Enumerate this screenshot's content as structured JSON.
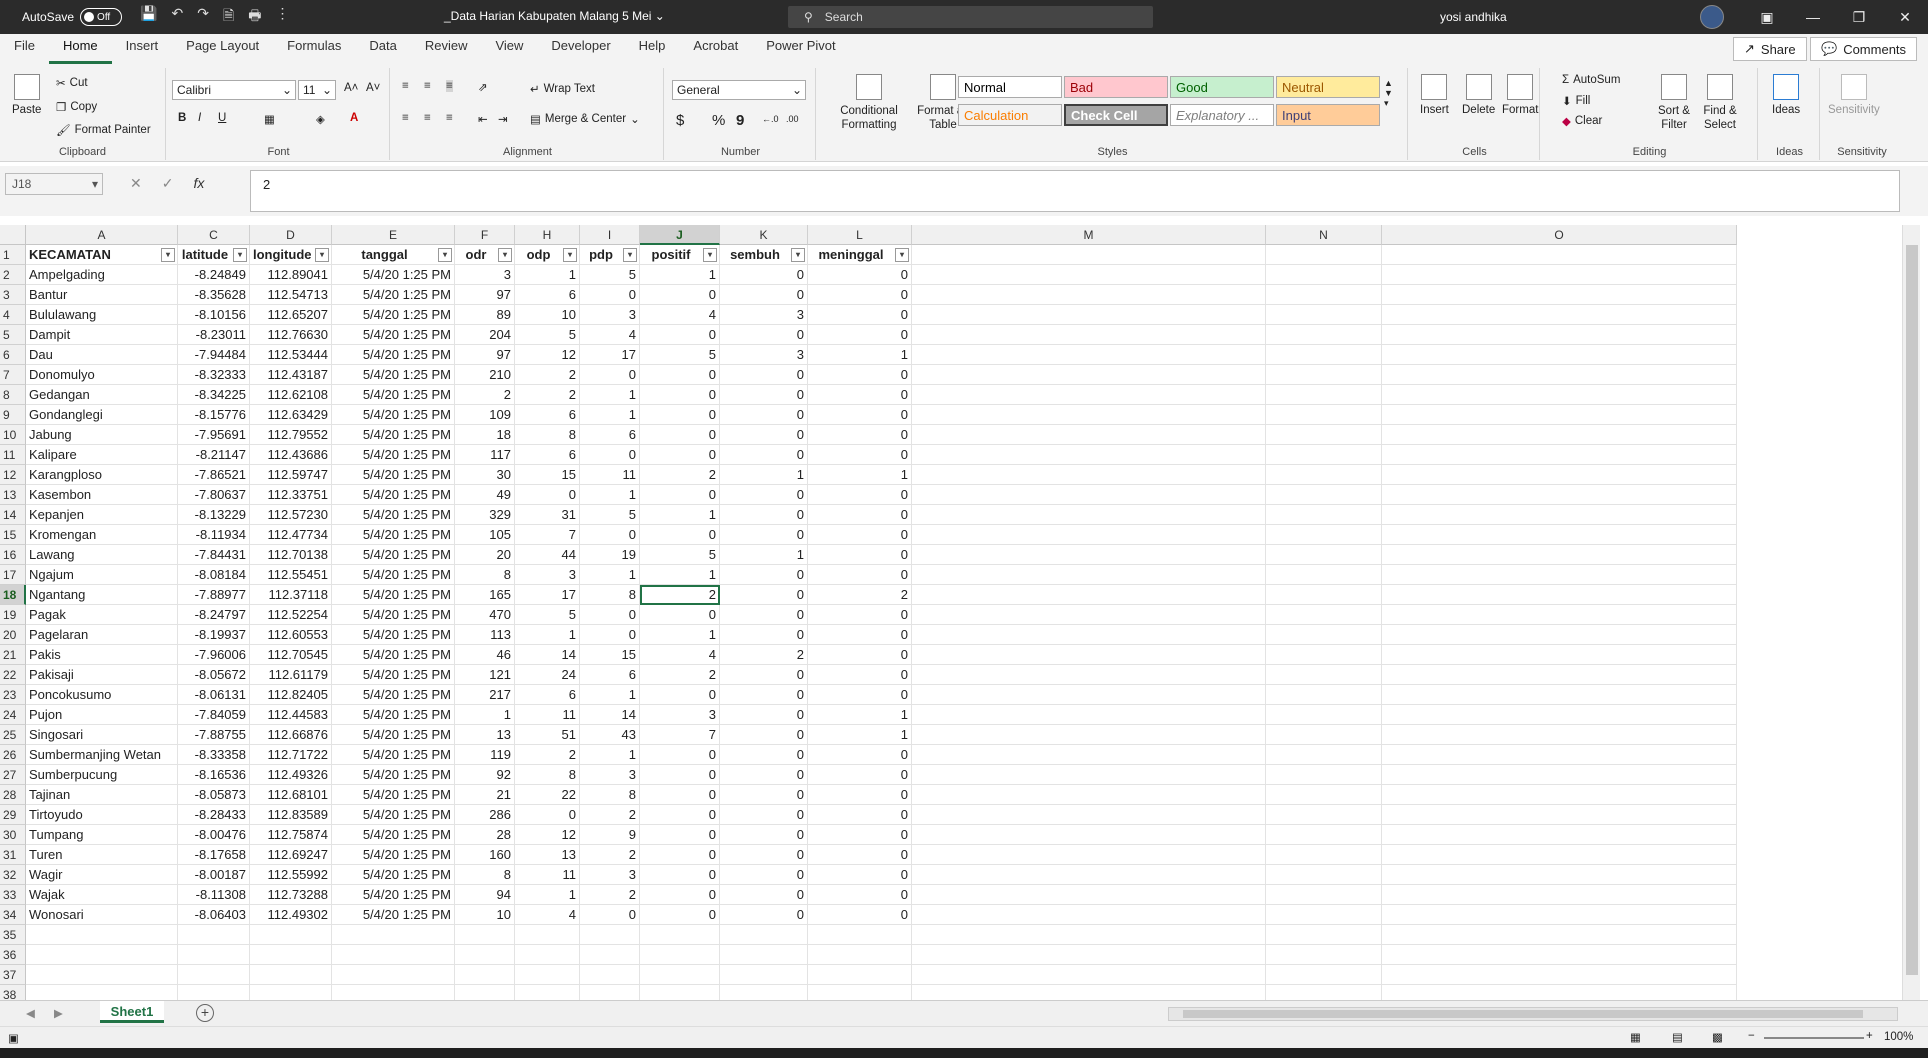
{
  "titlebar": {
    "autosave_label": "AutoSave",
    "autosave_state": "Off",
    "doc_title": "_Data Harian Kabupaten Malang 5 Mei ⌄",
    "search_placeholder": "Search",
    "user_name": "yosi andhika"
  },
  "menu": {
    "tabs": [
      "File",
      "Home",
      "Insert",
      "Page Layout",
      "Formulas",
      "Data",
      "Review",
      "View",
      "Developer",
      "Help",
      "Acrobat",
      "Power Pivot"
    ],
    "active": "Home",
    "share": "Share",
    "comments": "Comments"
  },
  "ribbon": {
    "clipboard": {
      "paste": "Paste",
      "cut": "Cut",
      "copy": "Copy",
      "format_painter": "Format Painter",
      "label": "Clipboard"
    },
    "font": {
      "name": "Calibri",
      "size": "11",
      "bold": "B",
      "italic": "I",
      "underline": "U",
      "label": "Font"
    },
    "alignment": {
      "wrap": "Wrap Text",
      "merge": "Merge & Center",
      "label": "Alignment"
    },
    "number": {
      "format": "General",
      "label": "Number"
    },
    "styles": {
      "conditional": "Conditional Formatting",
      "format_table": "Format as Table",
      "cells": [
        {
          "name": "Normal",
          "bg": "#ffffff",
          "fg": "#000000"
        },
        {
          "name": "Bad",
          "bg": "#ffc7ce",
          "fg": "#9c0006"
        },
        {
          "name": "Good",
          "bg": "#c6efce",
          "fg": "#006100"
        },
        {
          "name": "Neutral",
          "bg": "#ffeb9c",
          "fg": "#9c5700"
        },
        {
          "name": "Calculation",
          "bg": "#f2f2f2",
          "fg": "#fa7d00"
        },
        {
          "name": "Check Cell",
          "bg": "#a5a5a5",
          "fg": "#ffffff"
        },
        {
          "name": "Explanatory ...",
          "bg": "#ffffff",
          "fg": "#7f7f7f"
        },
        {
          "name": "Input",
          "bg": "#ffcc99",
          "fg": "#3f3f76"
        }
      ],
      "label": "Styles"
    },
    "cells": {
      "insert": "Insert",
      "delete": "Delete",
      "format": "Format",
      "label": "Cells"
    },
    "editing": {
      "autosum": "AutoSum",
      "fill": "Fill",
      "clear": "Clear",
      "sort": "Sort & Filter",
      "find": "Find & Select",
      "label": "Editing"
    },
    "ideas": {
      "ideas": "Ideas",
      "label": "Ideas"
    },
    "sensitivity": {
      "sensitivity": "Sensitivity",
      "label": "Sensitivity"
    }
  },
  "formula_bar": {
    "name_box": "J18",
    "fx": "fx",
    "value": "2"
  },
  "columns": [
    "A",
    "C",
    "D",
    "E",
    "F",
    "H",
    "I",
    "J",
    "K",
    "L",
    "M",
    "N",
    "O"
  ],
  "selected_column": "J",
  "selected_row": 18,
  "headers": [
    "KECAMATAN",
    "latitude",
    "longitude",
    "tanggal",
    "odr",
    "odp",
    "pdp",
    "positif",
    "sembuh",
    "meninggal"
  ],
  "rows": [
    [
      "Ampelgading",
      "-8.24849",
      "112.89041",
      "5/4/20 1:25 PM",
      "3",
      "1",
      "5",
      "1",
      "0",
      "0"
    ],
    [
      "Bantur",
      "-8.35628",
      "112.54713",
      "5/4/20 1:25 PM",
      "97",
      "6",
      "0",
      "0",
      "0",
      "0"
    ],
    [
      "Bululawang",
      "-8.10156",
      "112.65207",
      "5/4/20 1:25 PM",
      "89",
      "10",
      "3",
      "4",
      "3",
      "0"
    ],
    [
      "Dampit",
      "-8.23011",
      "112.76630",
      "5/4/20 1:25 PM",
      "204",
      "5",
      "4",
      "0",
      "0",
      "0"
    ],
    [
      "Dau",
      "-7.94484",
      "112.53444",
      "5/4/20 1:25 PM",
      "97",
      "12",
      "17",
      "5",
      "3",
      "1"
    ],
    [
      "Donomulyo",
      "-8.32333",
      "112.43187",
      "5/4/20 1:25 PM",
      "210",
      "2",
      "0",
      "0",
      "0",
      "0"
    ],
    [
      "Gedangan",
      "-8.34225",
      "112.62108",
      "5/4/20 1:25 PM",
      "2",
      "2",
      "1",
      "0",
      "0",
      "0"
    ],
    [
      "Gondanglegi",
      "-8.15776",
      "112.63429",
      "5/4/20 1:25 PM",
      "109",
      "6",
      "1",
      "0",
      "0",
      "0"
    ],
    [
      "Jabung",
      "-7.95691",
      "112.79552",
      "5/4/20 1:25 PM",
      "18",
      "8",
      "6",
      "0",
      "0",
      "0"
    ],
    [
      "Kalipare",
      "-8.21147",
      "112.43686",
      "5/4/20 1:25 PM",
      "117",
      "6",
      "0",
      "0",
      "0",
      "0"
    ],
    [
      "Karangploso",
      "-7.86521",
      "112.59747",
      "5/4/20 1:25 PM",
      "30",
      "15",
      "11",
      "2",
      "1",
      "1"
    ],
    [
      "Kasembon",
      "-7.80637",
      "112.33751",
      "5/4/20 1:25 PM",
      "49",
      "0",
      "1",
      "0",
      "0",
      "0"
    ],
    [
      "Kepanjen",
      "-8.13229",
      "112.57230",
      "5/4/20 1:25 PM",
      "329",
      "31",
      "5",
      "1",
      "0",
      "0"
    ],
    [
      "Kromengan",
      "-8.11934",
      "112.47734",
      "5/4/20 1:25 PM",
      "105",
      "7",
      "0",
      "0",
      "0",
      "0"
    ],
    [
      "Lawang",
      "-7.84431",
      "112.70138",
      "5/4/20 1:25 PM",
      "20",
      "44",
      "19",
      "5",
      "1",
      "0"
    ],
    [
      "Ngajum",
      "-8.08184",
      "112.55451",
      "5/4/20 1:25 PM",
      "8",
      "3",
      "1",
      "1",
      "0",
      "0"
    ],
    [
      "Ngantang",
      "-7.88977",
      "112.37118",
      "5/4/20 1:25 PM",
      "165",
      "17",
      "8",
      "2",
      "0",
      "2"
    ],
    [
      "Pagak",
      "-8.24797",
      "112.52254",
      "5/4/20 1:25 PM",
      "470",
      "5",
      "0",
      "0",
      "0",
      "0"
    ],
    [
      "Pagelaran",
      "-8.19937",
      "112.60553",
      "5/4/20 1:25 PM",
      "113",
      "1",
      "0",
      "1",
      "0",
      "0"
    ],
    [
      "Pakis",
      "-7.96006",
      "112.70545",
      "5/4/20 1:25 PM",
      "46",
      "14",
      "15",
      "4",
      "2",
      "0"
    ],
    [
      "Pakisaji",
      "-8.05672",
      "112.61179",
      "5/4/20 1:25 PM",
      "121",
      "24",
      "6",
      "2",
      "0",
      "0"
    ],
    [
      "Poncokusumo",
      "-8.06131",
      "112.82405",
      "5/4/20 1:25 PM",
      "217",
      "6",
      "1",
      "0",
      "0",
      "0"
    ],
    [
      "Pujon",
      "-7.84059",
      "112.44583",
      "5/4/20 1:25 PM",
      "1",
      "11",
      "14",
      "3",
      "0",
      "1"
    ],
    [
      "Singosari",
      "-7.88755",
      "112.66876",
      "5/4/20 1:25 PM",
      "13",
      "51",
      "43",
      "7",
      "0",
      "1"
    ],
    [
      "Sumbermanjing Wetan",
      "-8.33358",
      "112.71722",
      "5/4/20 1:25 PM",
      "119",
      "2",
      "1",
      "0",
      "0",
      "0"
    ],
    [
      "Sumberpucung",
      "-8.16536",
      "112.49326",
      "5/4/20 1:25 PM",
      "92",
      "8",
      "3",
      "0",
      "0",
      "0"
    ],
    [
      "Tajinan",
      "-8.05873",
      "112.68101",
      "5/4/20 1:25 PM",
      "21",
      "22",
      "8",
      "0",
      "0",
      "0"
    ],
    [
      "Tirtoyudo",
      "-8.28433",
      "112.83589",
      "5/4/20 1:25 PM",
      "286",
      "0",
      "2",
      "0",
      "0",
      "0"
    ],
    [
      "Tumpang",
      "-8.00476",
      "112.75874",
      "5/4/20 1:25 PM",
      "28",
      "12",
      "9",
      "0",
      "0",
      "0"
    ],
    [
      "Turen",
      "-8.17658",
      "112.69247",
      "5/4/20 1:25 PM",
      "160",
      "13",
      "2",
      "0",
      "0",
      "0"
    ],
    [
      "Wagir",
      "-8.00187",
      "112.55992",
      "5/4/20 1:25 PM",
      "8",
      "11",
      "3",
      "0",
      "0",
      "0"
    ],
    [
      "Wajak",
      "-8.11308",
      "112.73288",
      "5/4/20 1:25 PM",
      "94",
      "1",
      "2",
      "0",
      "0",
      "0"
    ],
    [
      "Wonosari",
      "-8.06403",
      "112.49302",
      "5/4/20 1:25 PM",
      "10",
      "4",
      "0",
      "0",
      "0",
      "0"
    ]
  ],
  "row_numbers": [
    "1",
    "2",
    "3",
    "4",
    "5",
    "6",
    "7",
    "8",
    "9",
    "10",
    "11",
    "12",
    "13",
    "14",
    "15",
    "16",
    "17",
    "18",
    "19",
    "20",
    "21",
    "22",
    "23",
    "24",
    "25",
    "26",
    "27",
    "28",
    "29",
    "30",
    "31",
    "32",
    "33",
    "34",
    "35",
    "36",
    "37",
    "38"
  ],
  "sheet_tab": "Sheet1",
  "status": {
    "zoom": "100%"
  },
  "colors": {
    "accent": "#217346",
    "titlebar": "#2b2b2b"
  }
}
